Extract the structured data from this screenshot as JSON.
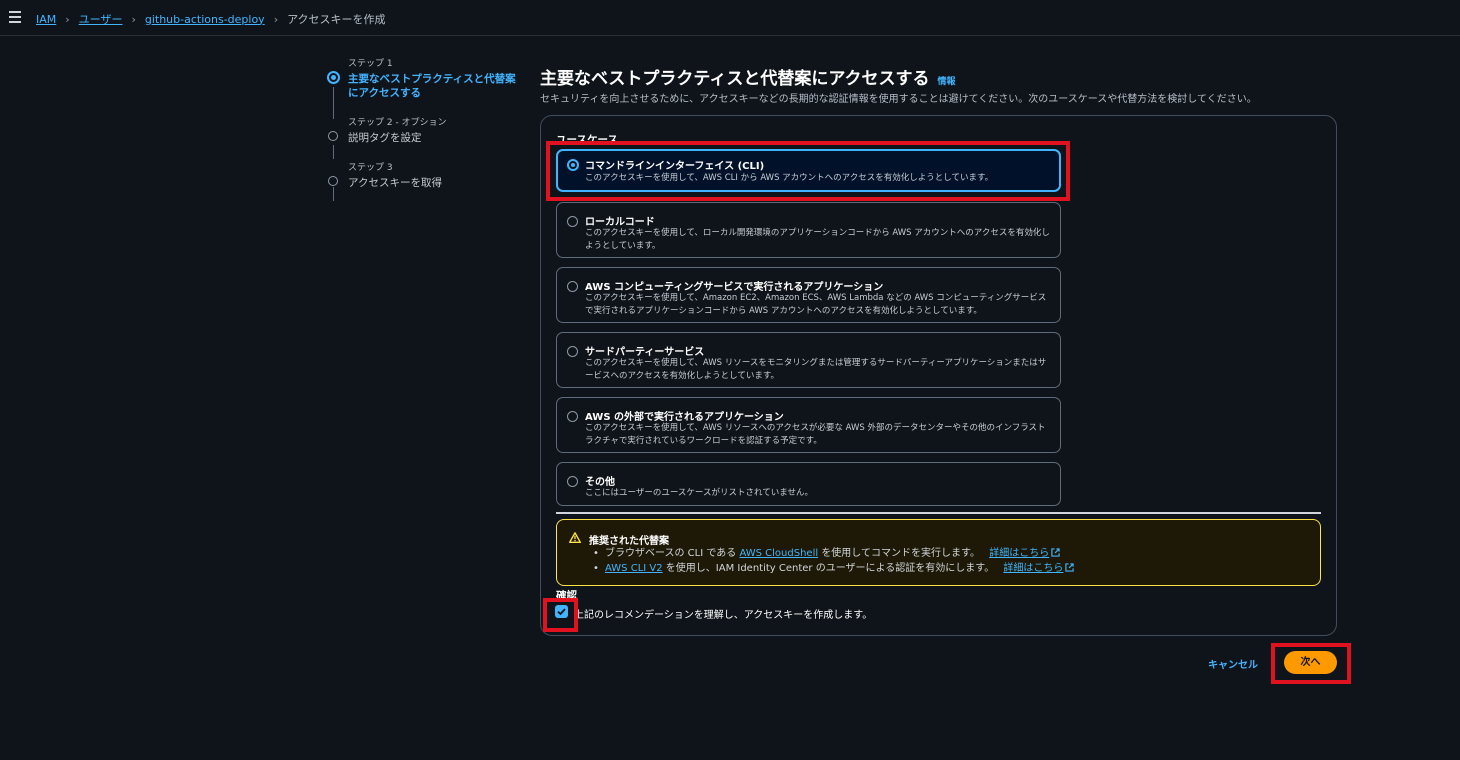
{
  "breadcrumb": {
    "items": [
      "IAM",
      "ユーザー",
      "github-actions-deploy"
    ],
    "current": "アクセスキーを作成"
  },
  "steps": [
    {
      "small": "ステップ 1",
      "title": "主要なベストプラクティスと代替案にアクセスする",
      "active": true
    },
    {
      "small": "ステップ 2 - オプション",
      "title": "説明タグを設定",
      "active": false
    },
    {
      "small": "ステップ 3",
      "title": "アクセスキーを取得",
      "active": false
    }
  ],
  "page": {
    "title": "主要なベストプラクティスと代替案にアクセスする",
    "info": "情報",
    "description": "セキュリティを向上させるために、アクセスキーなどの長期的な認証情報を使用することは避けてください。次のユースケースや代替方法を検討してください。"
  },
  "usecase": {
    "label": "ユースケース",
    "options": [
      {
        "title": "コマンドラインインターフェイス (CLI)",
        "desc": "このアクセスキーを使用して、AWS CLI から AWS アカウントへのアクセスを有効化しようとしています。",
        "selected": true
      },
      {
        "title": "ローカルコード",
        "desc": "このアクセスキーを使用して、ローカル開発環境のアプリケーションコードから AWS アカウントへのアクセスを有効化しようとしています。",
        "selected": false
      },
      {
        "title": "AWS コンピューティングサービスで実行されるアプリケーション",
        "desc": "このアクセスキーを使用して、Amazon EC2、Amazon ECS、AWS Lambda などの AWS コンピューティングサービスで実行されるアプリケーションコードから AWS アカウントへのアクセスを有効化しようとしています。",
        "selected": false
      },
      {
        "title": "サードパーティーサービス",
        "desc": "このアクセスキーを使用して、AWS リソースをモニタリングまたは管理するサードパーティーアプリケーションまたはサービスへのアクセスを有効化しようとしています。",
        "selected": false
      },
      {
        "title": "AWS の外部で実行されるアプリケーション",
        "desc": "このアクセスキーを使用して、AWS リソースへのアクセスが必要な AWS 外部のデータセンターやその他のインフラストラクチャで実行されているワークロードを認証する予定です。",
        "selected": false
      },
      {
        "title": "その他",
        "desc": "ここにはユーザーのユースケースがリストされていません。",
        "selected": false
      }
    ]
  },
  "alert": {
    "title": "推奨された代替案",
    "line1_pre": "ブラウザベースの CLI である",
    "line1_link": "AWS CloudShell",
    "line1_post": "を使用してコマンドを実行します。",
    "line1_more": "詳細はこちら",
    "line2_link": "AWS CLI V2",
    "line2_post": "を使用し、IAM Identity Center のユーザーによる認証を有効にします。",
    "line2_more": "詳細はこちら"
  },
  "confirm": {
    "label": "確認",
    "checkbox_label": "上記のレコメンデーションを理解し、アクセスキーを作成します。",
    "checked": true
  },
  "footer": {
    "cancel": "キャンセル",
    "next": "次へ"
  },
  "colors": {
    "accent": "#42b4ff",
    "primary_button": "#ff9900",
    "warning_border": "#ffe347",
    "annotation_red": "#e0121f"
  }
}
